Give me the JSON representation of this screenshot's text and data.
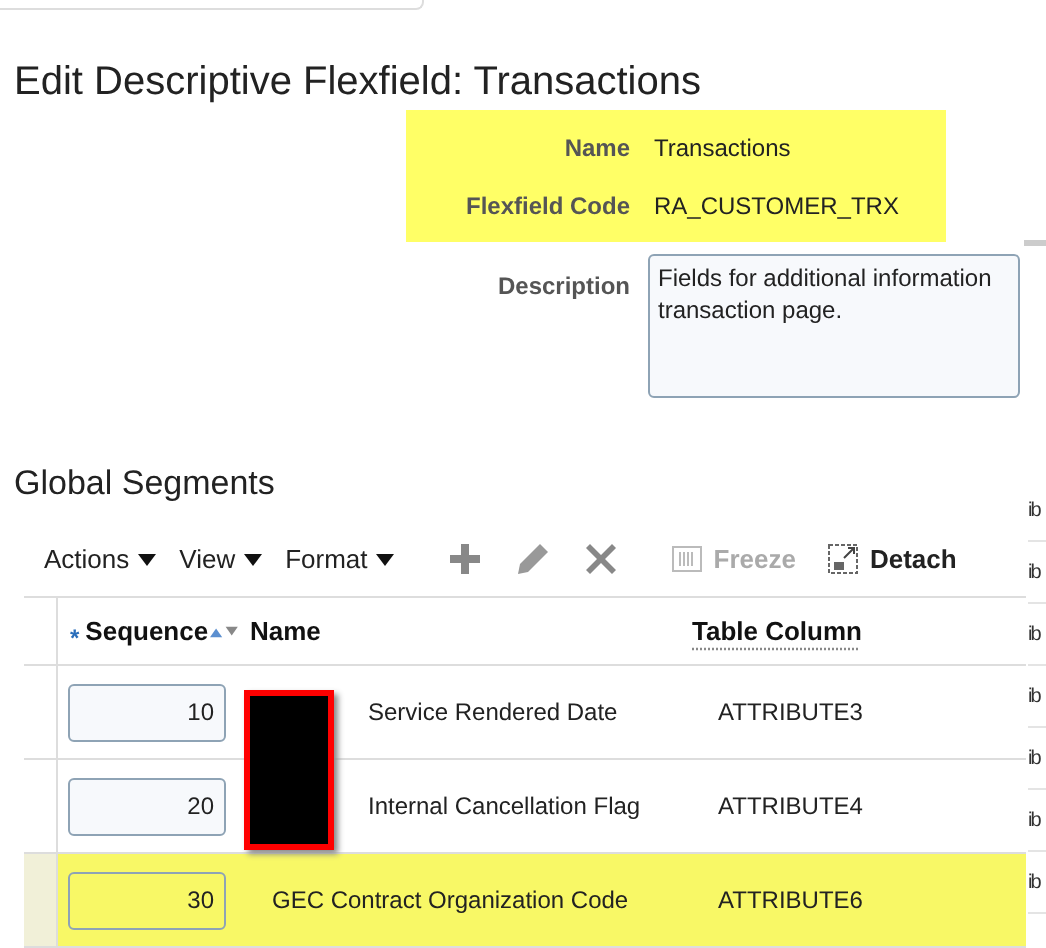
{
  "page_title": "Edit Descriptive Flexfield: Transactions",
  "header_highlighted": true,
  "header_fields": [
    {
      "label": "Name",
      "value": "Transactions"
    },
    {
      "label": "Flexfield Code",
      "value": "RA_CUSTOMER_TRX"
    }
  ],
  "description": {
    "label": "Description",
    "value": "Fields for additional information\ntransaction page."
  },
  "section_title": "Global Segments",
  "toolbar": {
    "menus": [
      "Actions",
      "View",
      "Format"
    ],
    "freeze": {
      "label": "Freeze",
      "disabled": true
    },
    "detach": {
      "label": "Detach",
      "disabled": false
    }
  },
  "table": {
    "columns": [
      {
        "label": "Sequence",
        "required_mark": "*"
      },
      {
        "label": "Name"
      },
      {
        "label": "Table Column"
      }
    ],
    "rows": [
      {
        "sequence": "10",
        "name": "Service Rendered Date",
        "table_column": "ATTRIBUTE3",
        "highlighted": false,
        "redacted": true
      },
      {
        "sequence": "20",
        "name": "Internal Cancellation Flag",
        "table_column": "ATTRIBUTE4",
        "highlighted": false,
        "redacted": true
      },
      {
        "sequence": "30",
        "name": "GEC Contract Organization Code",
        "table_column": "ATTRIBUTE6",
        "highlighted": true,
        "redacted": false
      }
    ]
  },
  "edge_fragments": [
    "ib",
    "ib",
    "ib",
    "ib",
    "ib",
    "ib",
    "ib"
  ]
}
